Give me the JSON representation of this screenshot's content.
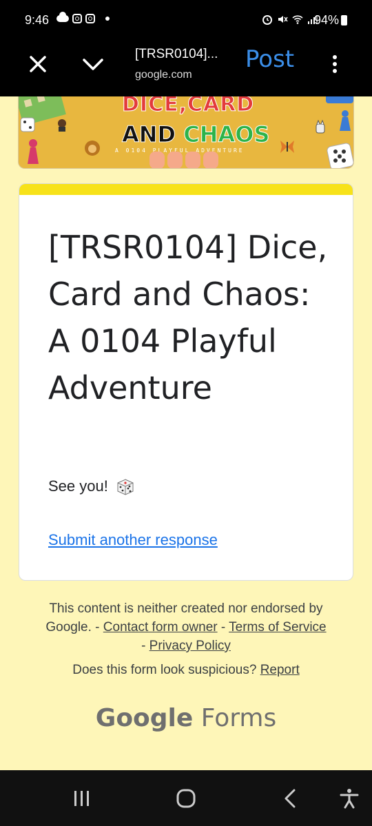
{
  "status_bar": {
    "time": "9:46",
    "battery": "94%"
  },
  "app_bar": {
    "title": "[TRSR0104]...",
    "url": "google.com",
    "post_label": "Post"
  },
  "banner": {
    "line1": "DICE,CARD",
    "line2_a": "AND ",
    "line2_b": "CHAOS",
    "subtitle": "A 0104 PLAYFUL ADVENTURE"
  },
  "card": {
    "title": "[TRSR0104] Dice, Card and Chaos: A 0104 Playful Adventure",
    "confirmation": "See you!",
    "submit_another": "Submit another response"
  },
  "footer": {
    "disclaimer": "This content is neither created nor endorsed by Google. -",
    "contact": "Contact form owner",
    "sep1": " - ",
    "terms": "Terms of Service",
    "sep2": " - ",
    "privacy": "Privacy Policy",
    "suspicious": "Does this form look suspicious?",
    "report": "Report",
    "brand_google": "Google",
    "brand_forms": "Forms"
  },
  "colors": {
    "page_bg": "#fef6b8",
    "accent": "#f7e21a",
    "link": "#1a73e8",
    "post": "#3b8ee8"
  },
  "icons": [
    "cloud-icon",
    "instagram-icon",
    "alarm-icon",
    "mute-icon",
    "wifi-icon",
    "signal-icon",
    "battery-icon",
    "close-icon",
    "chevron-down-icon",
    "more-vert-icon",
    "dice-icon",
    "recents-icon",
    "home-icon",
    "back-icon",
    "accessibility-icon"
  ]
}
